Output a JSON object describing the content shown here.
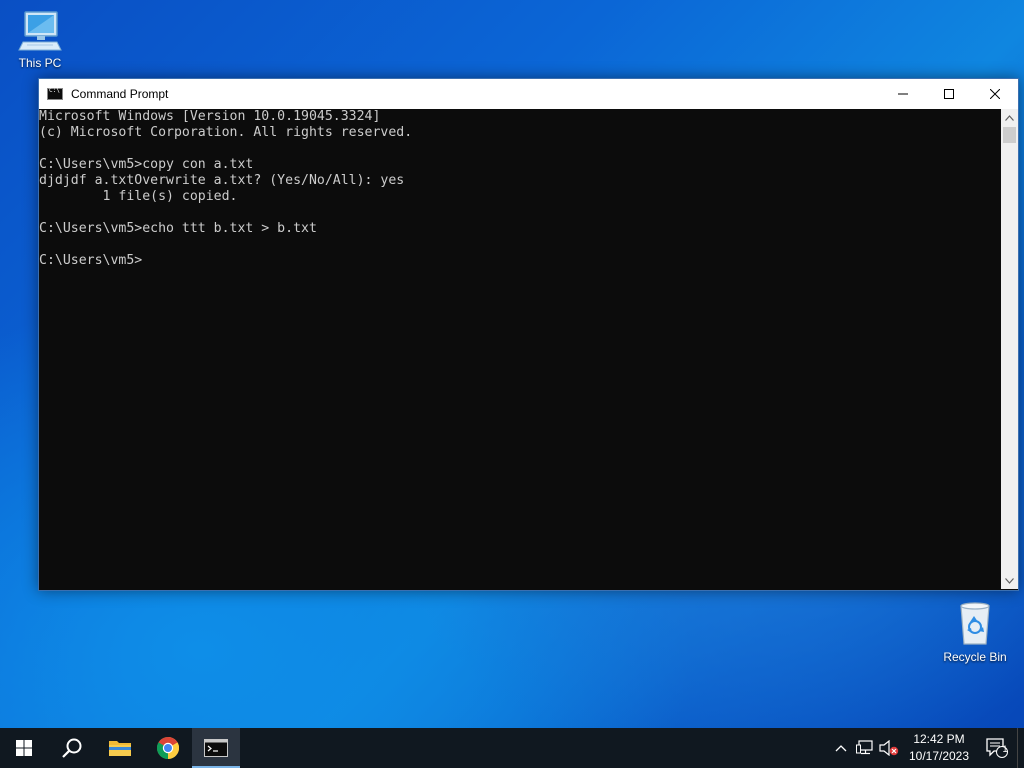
{
  "desktop": {
    "icons": [
      {
        "label": "This PC",
        "icon": "computer-icon"
      },
      {
        "label": "Recycle Bin",
        "icon": "recycle-bin-icon"
      }
    ]
  },
  "window": {
    "title": "Command Prompt",
    "icon": "cmd-icon",
    "controls": {
      "minimize": "─",
      "maximize": "□",
      "close": "✕"
    }
  },
  "console": {
    "lines": [
      "Microsoft Windows [Version 10.0.19045.3324]",
      "(c) Microsoft Corporation. All rights reserved.",
      "",
      "C:\\Users\\vm5>copy con a.txt",
      "djdjdf a.txtOverwrite a.txt? (Yes/No/All): yes",
      "        1 file(s) copied.",
      "",
      "C:\\Users\\vm5>echo ttt b.txt > b.txt",
      "",
      "C:\\Users\\vm5>"
    ],
    "foreground": "#cccccc",
    "background": "#0c0c0c"
  },
  "taskbar": {
    "items": [
      {
        "name": "start",
        "icon": "windows-logo-icon"
      },
      {
        "name": "search",
        "icon": "search-icon"
      },
      {
        "name": "file-explorer",
        "icon": "folder-icon"
      },
      {
        "name": "chrome",
        "icon": "chrome-icon"
      },
      {
        "name": "command-prompt",
        "icon": "cmd-icon",
        "active": true
      }
    ],
    "tray": {
      "icons": [
        "chevron-up-icon",
        "network-icon",
        "volume-muted-icon"
      ],
      "time": "12:42 PM",
      "date": "10/17/2023",
      "notification_count": "1"
    }
  },
  "colors": {
    "taskbar": "#101820",
    "accent": "#7ab4e8",
    "desktop": "#0b66d6"
  }
}
